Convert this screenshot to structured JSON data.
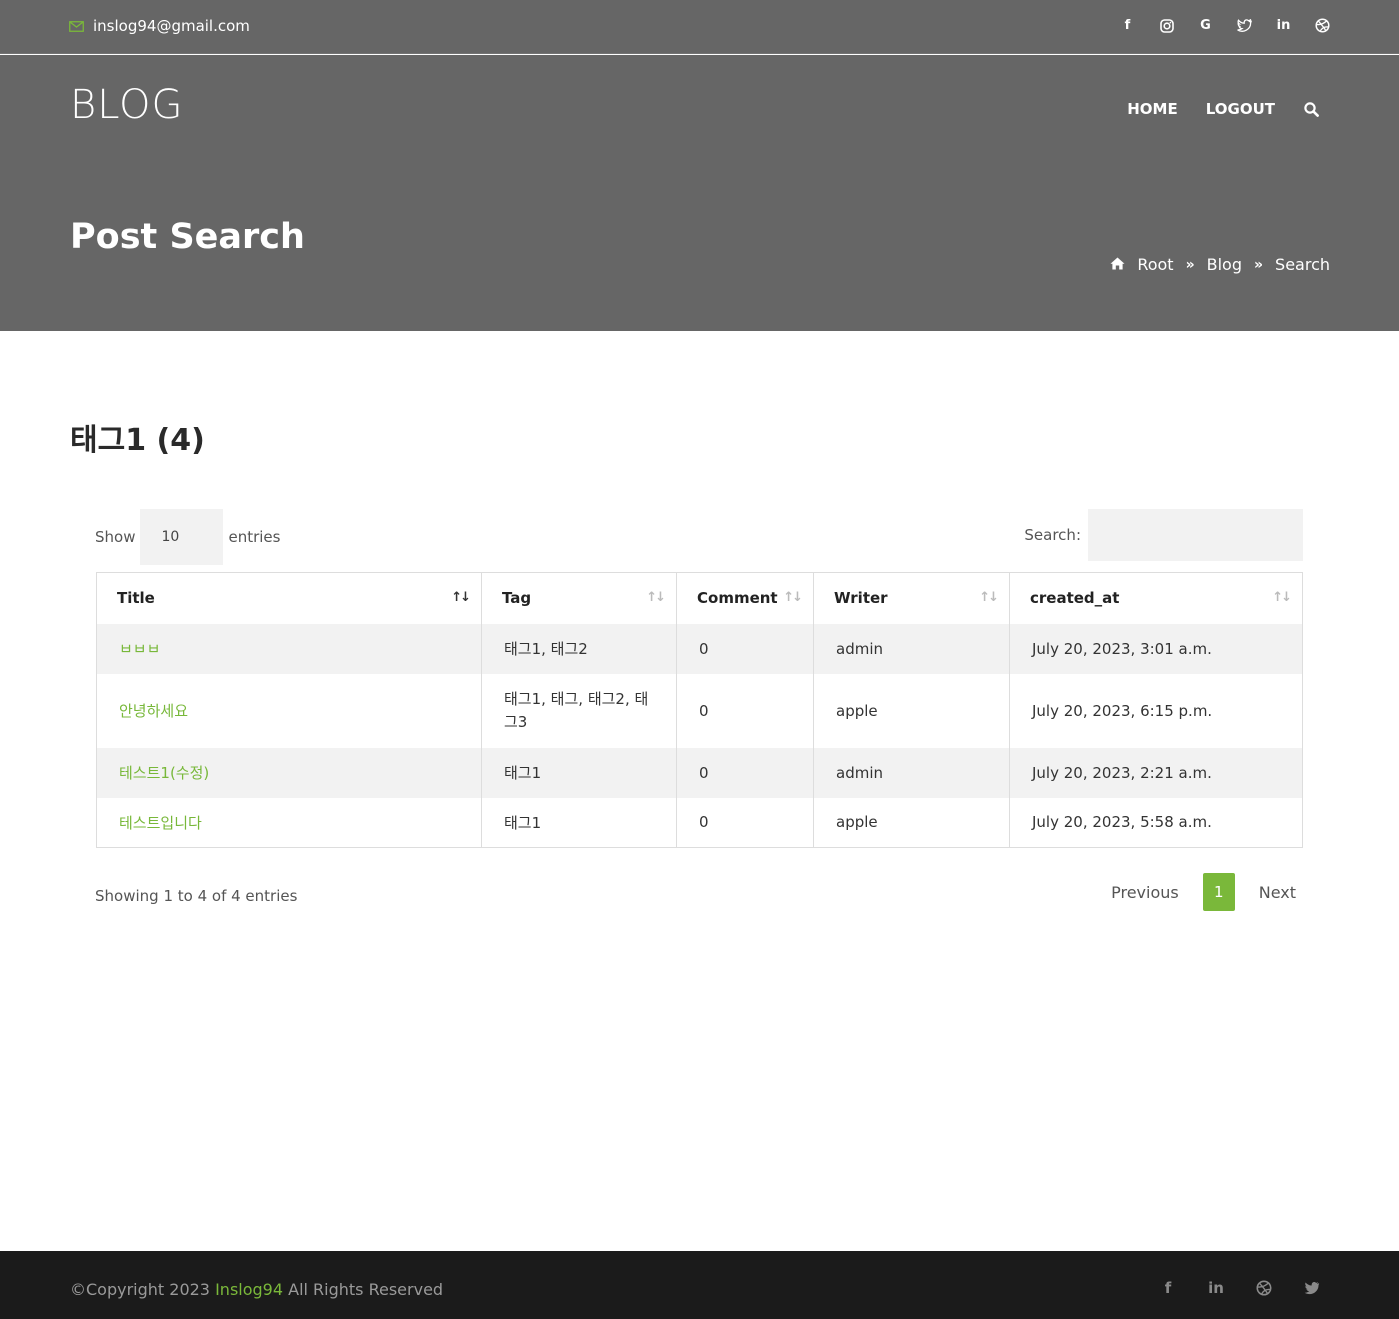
{
  "topbar": {
    "email": "inslog94@gmail.com",
    "social_icons": [
      "facebook-icon",
      "instagram-icon",
      "google-icon",
      "twitter-icon",
      "linkedin-icon",
      "dribbble-icon"
    ]
  },
  "header": {
    "brand": "BLOG",
    "nav": {
      "home": "HOME",
      "logout": "LOGOUT"
    },
    "page_title": "Post Search",
    "breadcrumb": {
      "root": "Root",
      "blog": "Blog",
      "search": "Search"
    }
  },
  "main": {
    "section_title": "태그1 (4)",
    "length": {
      "show": "Show",
      "value": "10",
      "entries": "entries"
    },
    "search": {
      "label": "Search:",
      "placeholder": ""
    },
    "table": {
      "columns": [
        "Title",
        "Tag",
        "Comment",
        "Writer",
        "created_at"
      ],
      "rows": [
        {
          "title": "ㅂㅂㅂ",
          "tag": "태그1, 태그2",
          "comment": "0",
          "writer": "admin",
          "created_at": "July 20, 2023, 3:01 a.m."
        },
        {
          "title": "안녕하세요",
          "tag": "태그1, 태그, 태그2, 태그3",
          "comment": "0",
          "writer": "apple",
          "created_at": "July 20, 2023, 6:15 p.m."
        },
        {
          "title": "테스트1(수정)",
          "tag": "태그1",
          "comment": "0",
          "writer": "admin",
          "created_at": "July 20, 2023, 2:21 a.m."
        },
        {
          "title": "테스트입니다",
          "tag": "태그1",
          "comment": "0",
          "writer": "apple",
          "created_at": "July 20, 2023, 5:58 a.m."
        }
      ]
    },
    "info": "Showing 1 to 4 of 4 entries",
    "pagination": {
      "previous": "Previous",
      "current": "1",
      "next": "Next"
    }
  },
  "footer": {
    "copyright_prefix": "©Copyright 2023 ",
    "copyright_brand": "Inslog94",
    "copyright_suffix": " All Rights Reserved",
    "social_icons": [
      "facebook-icon",
      "linkedin-icon",
      "dribbble-icon",
      "twitter-icon"
    ]
  },
  "colors": {
    "accent": "#7ab83a",
    "header_bg": "#666666",
    "footer_bg": "#1b1b1b"
  }
}
